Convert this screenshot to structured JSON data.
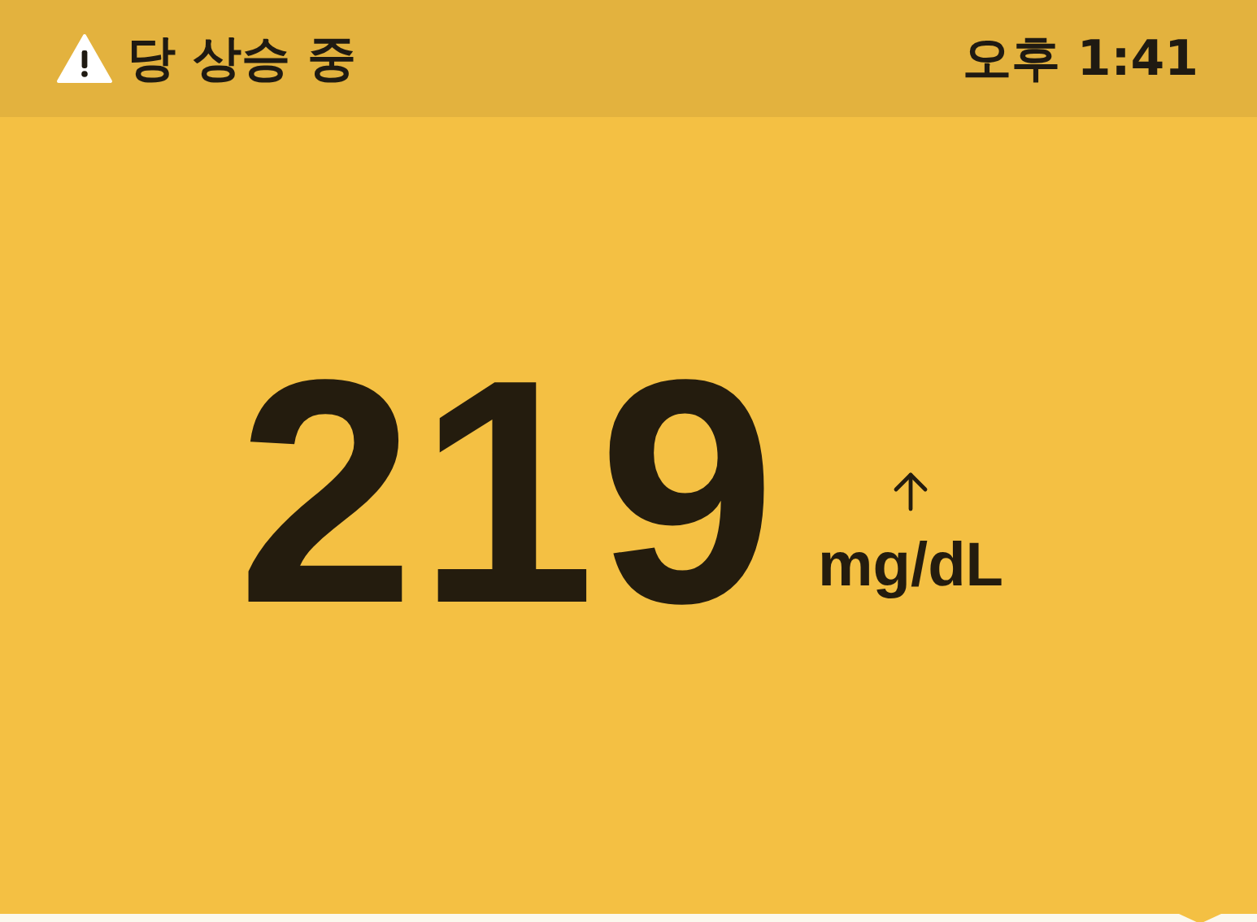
{
  "status_bar": {
    "alert": "당 상승 중",
    "time": "오후 1:41"
  },
  "reading": {
    "value": "219",
    "unit": "mg/dL",
    "rising": true
  }
}
